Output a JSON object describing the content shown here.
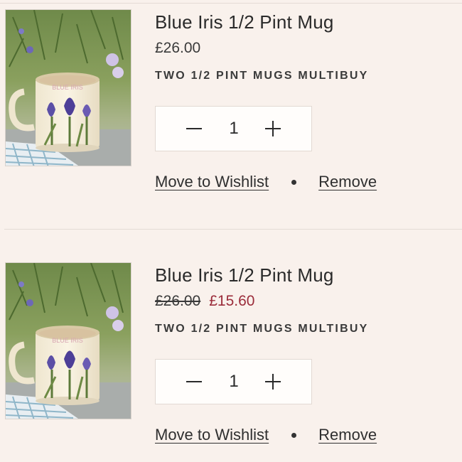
{
  "cart": {
    "items": [
      {
        "image_alt": "Blue Iris mug photo",
        "mug_text": "BLUE IRIS",
        "title": "Blue Iris 1/2 Pint Mug",
        "price": "£26.00",
        "promo": "TWO 1/2 PINT MUGS MULTIBUY",
        "quantity": "1",
        "wishlist_label": "Move to Wishlist",
        "remove_label": "Remove"
      },
      {
        "image_alt": "Blue Iris mug photo",
        "mug_text": "BLUE IRIS",
        "title": "Blue Iris 1/2 Pint Mug",
        "price_original": "£26.00",
        "price_sale": "£15.60",
        "promo": "TWO 1/2 PINT MUGS MULTIBUY",
        "quantity": "1",
        "wishlist_label": "Move to Wishlist",
        "remove_label": "Remove"
      }
    ]
  },
  "colors": {
    "background": "#f9f1ec",
    "sale_price": "#9b2c3a",
    "quantity_box": "#fffdfb"
  },
  "icons": {
    "decrease": "minus-icon",
    "increase": "plus-icon",
    "separator": "dot-separator"
  }
}
